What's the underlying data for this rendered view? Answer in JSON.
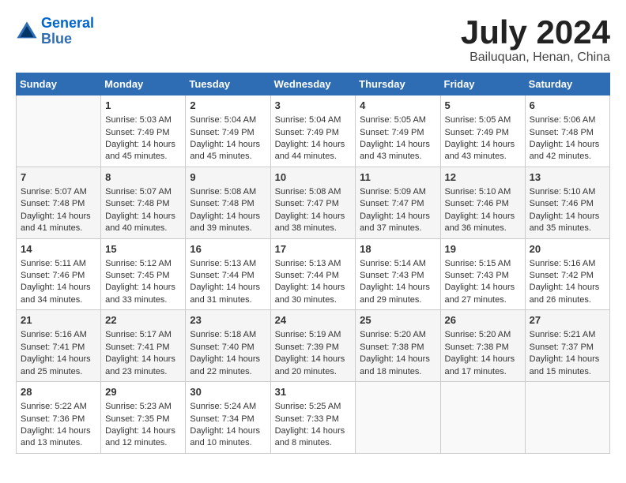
{
  "header": {
    "logo_line1": "General",
    "logo_line2": "Blue",
    "title": "July 2024",
    "subtitle": "Bailuquan, Henan, China"
  },
  "weekdays": [
    "Sunday",
    "Monday",
    "Tuesday",
    "Wednesday",
    "Thursday",
    "Friday",
    "Saturday"
  ],
  "weeks": [
    [
      {
        "day": "",
        "sunrise": "",
        "sunset": "",
        "daylight": ""
      },
      {
        "day": "1",
        "sunrise": "Sunrise: 5:03 AM",
        "sunset": "Sunset: 7:49 PM",
        "daylight": "Daylight: 14 hours and 45 minutes."
      },
      {
        "day": "2",
        "sunrise": "Sunrise: 5:04 AM",
        "sunset": "Sunset: 7:49 PM",
        "daylight": "Daylight: 14 hours and 45 minutes."
      },
      {
        "day": "3",
        "sunrise": "Sunrise: 5:04 AM",
        "sunset": "Sunset: 7:49 PM",
        "daylight": "Daylight: 14 hours and 44 minutes."
      },
      {
        "day": "4",
        "sunrise": "Sunrise: 5:05 AM",
        "sunset": "Sunset: 7:49 PM",
        "daylight": "Daylight: 14 hours and 43 minutes."
      },
      {
        "day": "5",
        "sunrise": "Sunrise: 5:05 AM",
        "sunset": "Sunset: 7:49 PM",
        "daylight": "Daylight: 14 hours and 43 minutes."
      },
      {
        "day": "6",
        "sunrise": "Sunrise: 5:06 AM",
        "sunset": "Sunset: 7:48 PM",
        "daylight": "Daylight: 14 hours and 42 minutes."
      }
    ],
    [
      {
        "day": "7",
        "sunrise": "Sunrise: 5:07 AM",
        "sunset": "Sunset: 7:48 PM",
        "daylight": "Daylight: 14 hours and 41 minutes."
      },
      {
        "day": "8",
        "sunrise": "Sunrise: 5:07 AM",
        "sunset": "Sunset: 7:48 PM",
        "daylight": "Daylight: 14 hours and 40 minutes."
      },
      {
        "day": "9",
        "sunrise": "Sunrise: 5:08 AM",
        "sunset": "Sunset: 7:48 PM",
        "daylight": "Daylight: 14 hours and 39 minutes."
      },
      {
        "day": "10",
        "sunrise": "Sunrise: 5:08 AM",
        "sunset": "Sunset: 7:47 PM",
        "daylight": "Daylight: 14 hours and 38 minutes."
      },
      {
        "day": "11",
        "sunrise": "Sunrise: 5:09 AM",
        "sunset": "Sunset: 7:47 PM",
        "daylight": "Daylight: 14 hours and 37 minutes."
      },
      {
        "day": "12",
        "sunrise": "Sunrise: 5:10 AM",
        "sunset": "Sunset: 7:46 PM",
        "daylight": "Daylight: 14 hours and 36 minutes."
      },
      {
        "day": "13",
        "sunrise": "Sunrise: 5:10 AM",
        "sunset": "Sunset: 7:46 PM",
        "daylight": "Daylight: 14 hours and 35 minutes."
      }
    ],
    [
      {
        "day": "14",
        "sunrise": "Sunrise: 5:11 AM",
        "sunset": "Sunset: 7:46 PM",
        "daylight": "Daylight: 14 hours and 34 minutes."
      },
      {
        "day": "15",
        "sunrise": "Sunrise: 5:12 AM",
        "sunset": "Sunset: 7:45 PM",
        "daylight": "Daylight: 14 hours and 33 minutes."
      },
      {
        "day": "16",
        "sunrise": "Sunrise: 5:13 AM",
        "sunset": "Sunset: 7:44 PM",
        "daylight": "Daylight: 14 hours and 31 minutes."
      },
      {
        "day": "17",
        "sunrise": "Sunrise: 5:13 AM",
        "sunset": "Sunset: 7:44 PM",
        "daylight": "Daylight: 14 hours and 30 minutes."
      },
      {
        "day": "18",
        "sunrise": "Sunrise: 5:14 AM",
        "sunset": "Sunset: 7:43 PM",
        "daylight": "Daylight: 14 hours and 29 minutes."
      },
      {
        "day": "19",
        "sunrise": "Sunrise: 5:15 AM",
        "sunset": "Sunset: 7:43 PM",
        "daylight": "Daylight: 14 hours and 27 minutes."
      },
      {
        "day": "20",
        "sunrise": "Sunrise: 5:16 AM",
        "sunset": "Sunset: 7:42 PM",
        "daylight": "Daylight: 14 hours and 26 minutes."
      }
    ],
    [
      {
        "day": "21",
        "sunrise": "Sunrise: 5:16 AM",
        "sunset": "Sunset: 7:41 PM",
        "daylight": "Daylight: 14 hours and 25 minutes."
      },
      {
        "day": "22",
        "sunrise": "Sunrise: 5:17 AM",
        "sunset": "Sunset: 7:41 PM",
        "daylight": "Daylight: 14 hours and 23 minutes."
      },
      {
        "day": "23",
        "sunrise": "Sunrise: 5:18 AM",
        "sunset": "Sunset: 7:40 PM",
        "daylight": "Daylight: 14 hours and 22 minutes."
      },
      {
        "day": "24",
        "sunrise": "Sunrise: 5:19 AM",
        "sunset": "Sunset: 7:39 PM",
        "daylight": "Daylight: 14 hours and 20 minutes."
      },
      {
        "day": "25",
        "sunrise": "Sunrise: 5:20 AM",
        "sunset": "Sunset: 7:38 PM",
        "daylight": "Daylight: 14 hours and 18 minutes."
      },
      {
        "day": "26",
        "sunrise": "Sunrise: 5:20 AM",
        "sunset": "Sunset: 7:38 PM",
        "daylight": "Daylight: 14 hours and 17 minutes."
      },
      {
        "day": "27",
        "sunrise": "Sunrise: 5:21 AM",
        "sunset": "Sunset: 7:37 PM",
        "daylight": "Daylight: 14 hours and 15 minutes."
      }
    ],
    [
      {
        "day": "28",
        "sunrise": "Sunrise: 5:22 AM",
        "sunset": "Sunset: 7:36 PM",
        "daylight": "Daylight: 14 hours and 13 minutes."
      },
      {
        "day": "29",
        "sunrise": "Sunrise: 5:23 AM",
        "sunset": "Sunset: 7:35 PM",
        "daylight": "Daylight: 14 hours and 12 minutes."
      },
      {
        "day": "30",
        "sunrise": "Sunrise: 5:24 AM",
        "sunset": "Sunset: 7:34 PM",
        "daylight": "Daylight: 14 hours and 10 minutes."
      },
      {
        "day": "31",
        "sunrise": "Sunrise: 5:25 AM",
        "sunset": "Sunset: 7:33 PM",
        "daylight": "Daylight: 14 hours and 8 minutes."
      },
      {
        "day": "",
        "sunrise": "",
        "sunset": "",
        "daylight": ""
      },
      {
        "day": "",
        "sunrise": "",
        "sunset": "",
        "daylight": ""
      },
      {
        "day": "",
        "sunrise": "",
        "sunset": "",
        "daylight": ""
      }
    ]
  ]
}
